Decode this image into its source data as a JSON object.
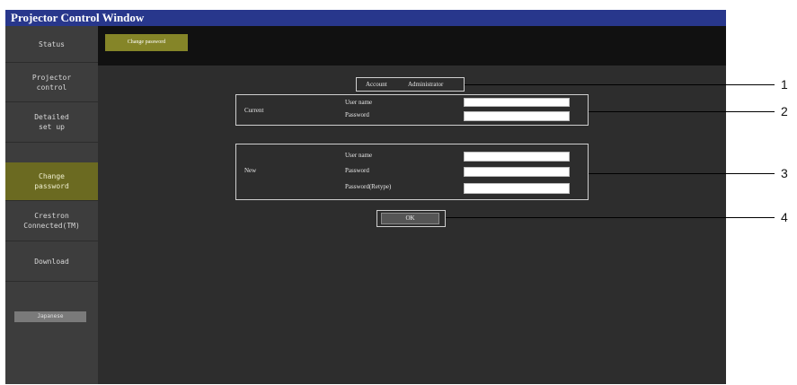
{
  "window": {
    "title": "Projector Control Window"
  },
  "sidebar": {
    "items": [
      {
        "label": "Status",
        "active": false
      },
      {
        "label": "Projector\ncontrol",
        "active": false
      },
      {
        "label": "Detailed\nset up",
        "active": false
      },
      {
        "label": "Change\npassword",
        "active": true
      },
      {
        "label": "Crestron\nConnected(TM)",
        "active": false
      },
      {
        "label": "Download",
        "active": false
      }
    ],
    "language_button": "Japanese"
  },
  "topbar": {
    "tab_label": "Change password"
  },
  "form": {
    "account_label": "Account",
    "account_value": "Administrator",
    "current": {
      "section_label": "Current",
      "username_label": "User name",
      "password_label": "Password",
      "username_value": "",
      "password_value": ""
    },
    "new": {
      "section_label": "New",
      "username_label": "User name",
      "password_label": "Password",
      "password_retype_label": "Password(Retype)",
      "username_value": "",
      "password_value": "",
      "password_retype_value": ""
    },
    "ok_label": "OK"
  },
  "callouts": [
    "1",
    "2",
    "3",
    "4"
  ],
  "colors": {
    "title_bar": "#28378c",
    "active_item": "#6b6a21",
    "tab_button": "#858528"
  }
}
